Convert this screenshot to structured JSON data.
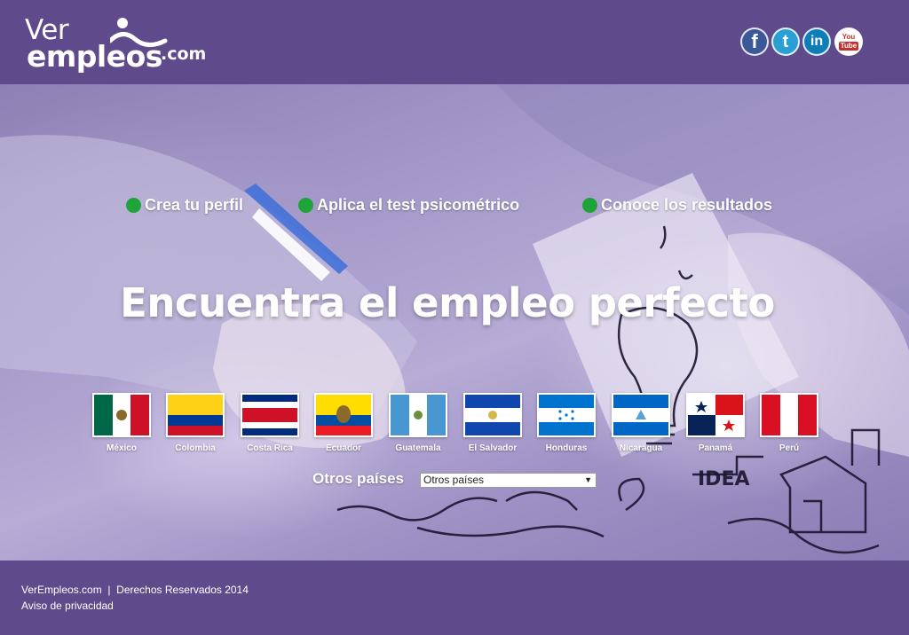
{
  "header": {
    "logo": {
      "ver": "Ver",
      "empleos": "empleos",
      "dotcom": ".com"
    },
    "social": {
      "facebook": "f",
      "twitter": "t",
      "linkedin": "in",
      "youtube_top": "You",
      "youtube_bottom": "Tube"
    }
  },
  "hero": {
    "steps": [
      "Crea tu perfil",
      "Aplica el test psicométrico",
      "Conoce los resultados"
    ],
    "headline": "Encuentra el empleo perfecto",
    "countries": [
      "México",
      "Colombia",
      "Costa Rica",
      "Ecuador",
      "Guatemala",
      "El Salvador",
      "Honduras",
      "Nicaragua",
      "Panamá",
      "Perú"
    ],
    "other_label": "Otros países",
    "other_select": "Otros países",
    "sketch_text": "IDEA"
  },
  "footer": {
    "copyright": "VerEmpleos.com  |  Derechos Reservados 2014",
    "privacy": "Aviso de privacidad"
  },
  "colors": {
    "brand": "#5f4b8b",
    "step_dot": "#1fa33a"
  }
}
